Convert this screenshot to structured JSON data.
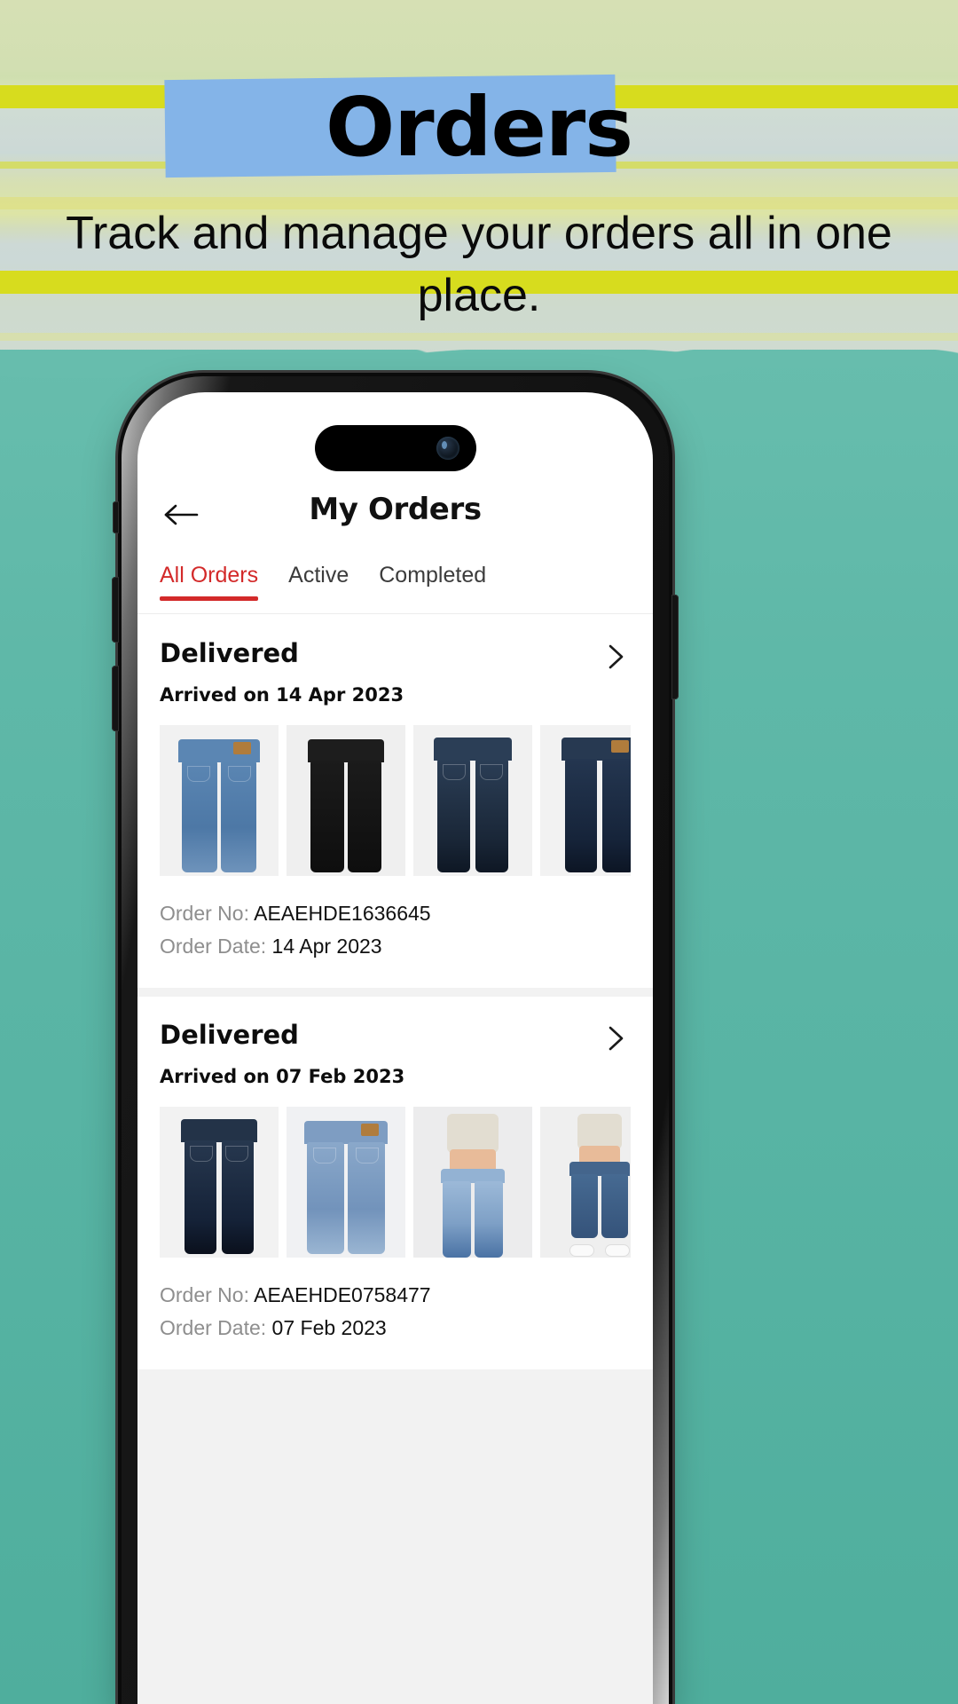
{
  "promo": {
    "title": "Orders",
    "subtitle": "Track and manage your orders all in one place.",
    "title_box_color": "#84b4e8",
    "band_color": "#d7dc1e",
    "bottom_color": "#5fb8a8"
  },
  "app": {
    "back_icon": "back-arrow-icon",
    "title": "My Orders",
    "accent_color": "#d32a2a"
  },
  "tabs": [
    {
      "label": "All Orders",
      "active": true
    },
    {
      "label": "Active",
      "active": false
    },
    {
      "label": "Completed",
      "active": false
    }
  ],
  "orders": [
    {
      "status": "Delivered",
      "arrived": "Arrived on 14 Apr 2023",
      "chevron_icon": "chevron-right-icon",
      "order_no_label": "Order No:",
      "order_no_value": "AEAEHDE1636645",
      "order_date_label": "Order Date:",
      "order_date_value": "14 Apr 2023",
      "items": [
        {
          "name": "medium-wash-straight-jeans",
          "denim": "#5b86b3",
          "waist": "#5b86b3",
          "bg": "#f1f1f1",
          "tag": true
        },
        {
          "name": "black-jeans",
          "denim": "#191919",
          "waist": "#1d1d1d",
          "bg": "#efefef",
          "tag": false
        },
        {
          "name": "dark-wash-slim-jeans",
          "denim": "#223349",
          "waist": "#2b3e56",
          "bg": "#f1f1f1",
          "tag": false
        },
        {
          "name": "indigo-skinny-jeans",
          "denim": "#1e2e46",
          "waist": "#27395180",
          "bg": "#f2f2f2",
          "tag": true
        }
      ]
    },
    {
      "status": "Delivered",
      "arrived": "Arrived on 07 Feb 2023",
      "chevron_icon": "chevron-right-icon",
      "order_no_label": "Order No:",
      "order_no_value": "AEAEHDE0758477",
      "order_date_label": "Order Date:",
      "order_date_value": "07 Feb 2023",
      "items": [
        {
          "name": "dark-wash-tapered-jeans",
          "denim": "#1b2a3d",
          "waist": "#233348",
          "bg": "#f2f2f2",
          "tag": false
        },
        {
          "name": "light-wash-baggy-jeans",
          "denim": "#7e9dc2",
          "waist": "#7e9dc2",
          "bg": "#f0f1f3",
          "tag": true
        },
        {
          "name": "light-wash-flare-jeans-model",
          "denim": "#93b2d3",
          "waist": "#93b2d3",
          "bg": "#ececed",
          "model": true
        },
        {
          "name": "cropped-jeans-model-side",
          "denim": "#3f5f86",
          "waist": "#44658c",
          "bg": "#efefef",
          "model": true
        }
      ]
    }
  ]
}
